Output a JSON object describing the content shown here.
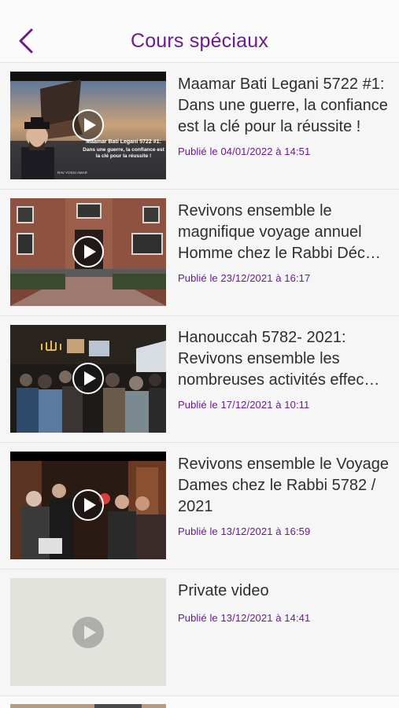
{
  "header": {
    "title": "Cours spéciaux",
    "back_icon": "chevron-left-icon"
  },
  "colors": {
    "accent": "#6a1b8f",
    "text": "#2e2e2e",
    "divider": "#e4e2e4",
    "background": "#f7f6f7"
  },
  "videos": [
    {
      "title": "Maamar Bati Legani 5722 #1: Dans une guerre, la confiance est la clé pour la réussite !",
      "date": "Publié le 04/01/2022 à 14:51",
      "thumb_caption": "Maamar Bati Legani 5722 #1:",
      "thumb_sub": "Dans une guerre, la confiance est la clé pour la réussite !",
      "thumb_author": "RAV YOSSI AMAR"
    },
    {
      "title": "Revivons ensemble le magnifique voyage annuel Homme chez le Rabbi Déc…",
      "date": "Publié le 23/12/2021 à 16:17"
    },
    {
      "title": "Hanouccah 5782- 2021: Revivons ensemble les nombreuses activités effec…",
      "date": "Publié le 17/12/2021 à 10:11"
    },
    {
      "title": "Revivons ensemble le Voyage Dames chez le Rabbi 5782 / 2021",
      "date": "Publié le 13/12/2021 à 16:59"
    },
    {
      "title": "Private video",
      "date": "Publié le 13/12/2021 à 14:41"
    }
  ]
}
